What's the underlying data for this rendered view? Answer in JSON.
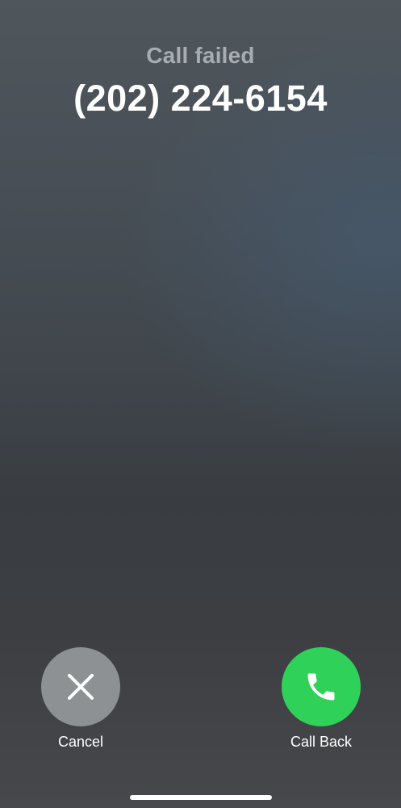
{
  "call": {
    "status": "Call failed",
    "number": "(202) 224-6154"
  },
  "actions": {
    "cancel_label": "Cancel",
    "call_back_label": "Call Back"
  },
  "icons": {
    "cancel": "close-icon",
    "call_back": "phone-icon"
  },
  "colors": {
    "call_back_accent": "#30d158",
    "cancel_button": "#8e9193"
  }
}
